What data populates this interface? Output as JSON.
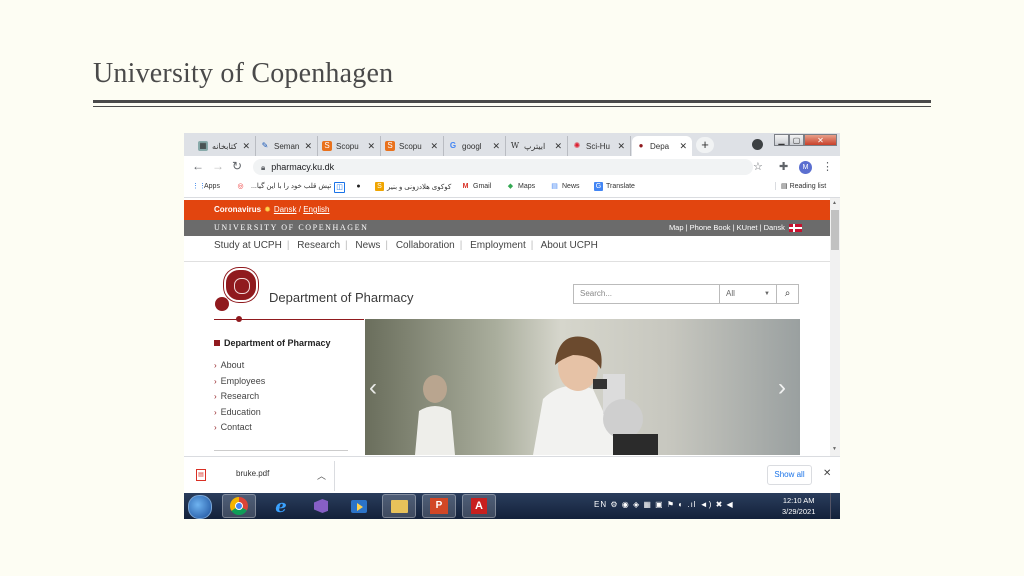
{
  "slide": {
    "title": "University of Copenhagen"
  },
  "browser": {
    "tabs": [
      {
        "label": "کتابخانه",
        "icon": "library-icon",
        "active": false
      },
      {
        "label": "Seman",
        "icon": "semantic-scholar-icon",
        "active": false
      },
      {
        "label": "Scopu",
        "icon": "scopus-icon",
        "active": false
      },
      {
        "label": "Scopu",
        "icon": "scopus-icon",
        "active": false
      },
      {
        "label": "googl",
        "icon": "google-icon",
        "active": false
      },
      {
        "label": "ابیترپ",
        "icon": "wikipedia-icon",
        "active": false
      },
      {
        "label": "Sci-Hu",
        "icon": "scihub-icon",
        "active": false
      },
      {
        "label": "Depa",
        "icon": "ku-icon",
        "active": true
      }
    ],
    "new_tab": "+",
    "url": "pharmacy.ku.dk",
    "profile_initial": "M",
    "bookmarks": [
      {
        "label": "Apps",
        "icon": "apps-grid-icon"
      },
      {
        "label": "",
        "icon": "red-circle-icon"
      },
      {
        "label": "...تپش قلب خود را با این گیا",
        "icon": "site-icon"
      },
      {
        "label": "",
        "icon": "blue-square-icon"
      },
      {
        "label": "",
        "icon": "github-icon"
      },
      {
        "label": "کوکوی هلادزونی و بنیر",
        "icon": "s-icon"
      },
      {
        "label": "Gmail",
        "icon": "gmail-icon"
      },
      {
        "label": "Maps",
        "icon": "maps-icon"
      },
      {
        "label": "News",
        "icon": "news-icon"
      },
      {
        "label": "Translate",
        "icon": "translate-icon"
      }
    ],
    "reading_list": "Reading list"
  },
  "site": {
    "covid_label": "Coronavirus",
    "covid_dansk": "Dansk",
    "covid_sep": "/",
    "covid_english": "English",
    "brand": "UNIVERSITY OF COPENHAGEN",
    "top_links": [
      "Map",
      "Phone Book",
      "KUnet",
      "Dansk"
    ],
    "nav": [
      "Study at UCPH",
      "Research",
      "News",
      "Collaboration",
      "Employment",
      "About UCPH"
    ],
    "dept_title": "Department of Pharmacy",
    "search_placeholder": "Search...",
    "search_scope": "All",
    "side_heading": "Department of Pharmacy",
    "side_items": [
      "About",
      "Employees",
      "Research",
      "Education",
      "Contact"
    ]
  },
  "downloads": {
    "file": "bruke.pdf",
    "show_all": "Show all"
  },
  "taskbar": {
    "lang": "EN",
    "time": "12:10 AM",
    "date": "3/29/2021"
  },
  "colors": {
    "ku_red": "#901a1e",
    "covid_orange": "#e2450f",
    "ucph_grey": "#6b6b6b"
  }
}
